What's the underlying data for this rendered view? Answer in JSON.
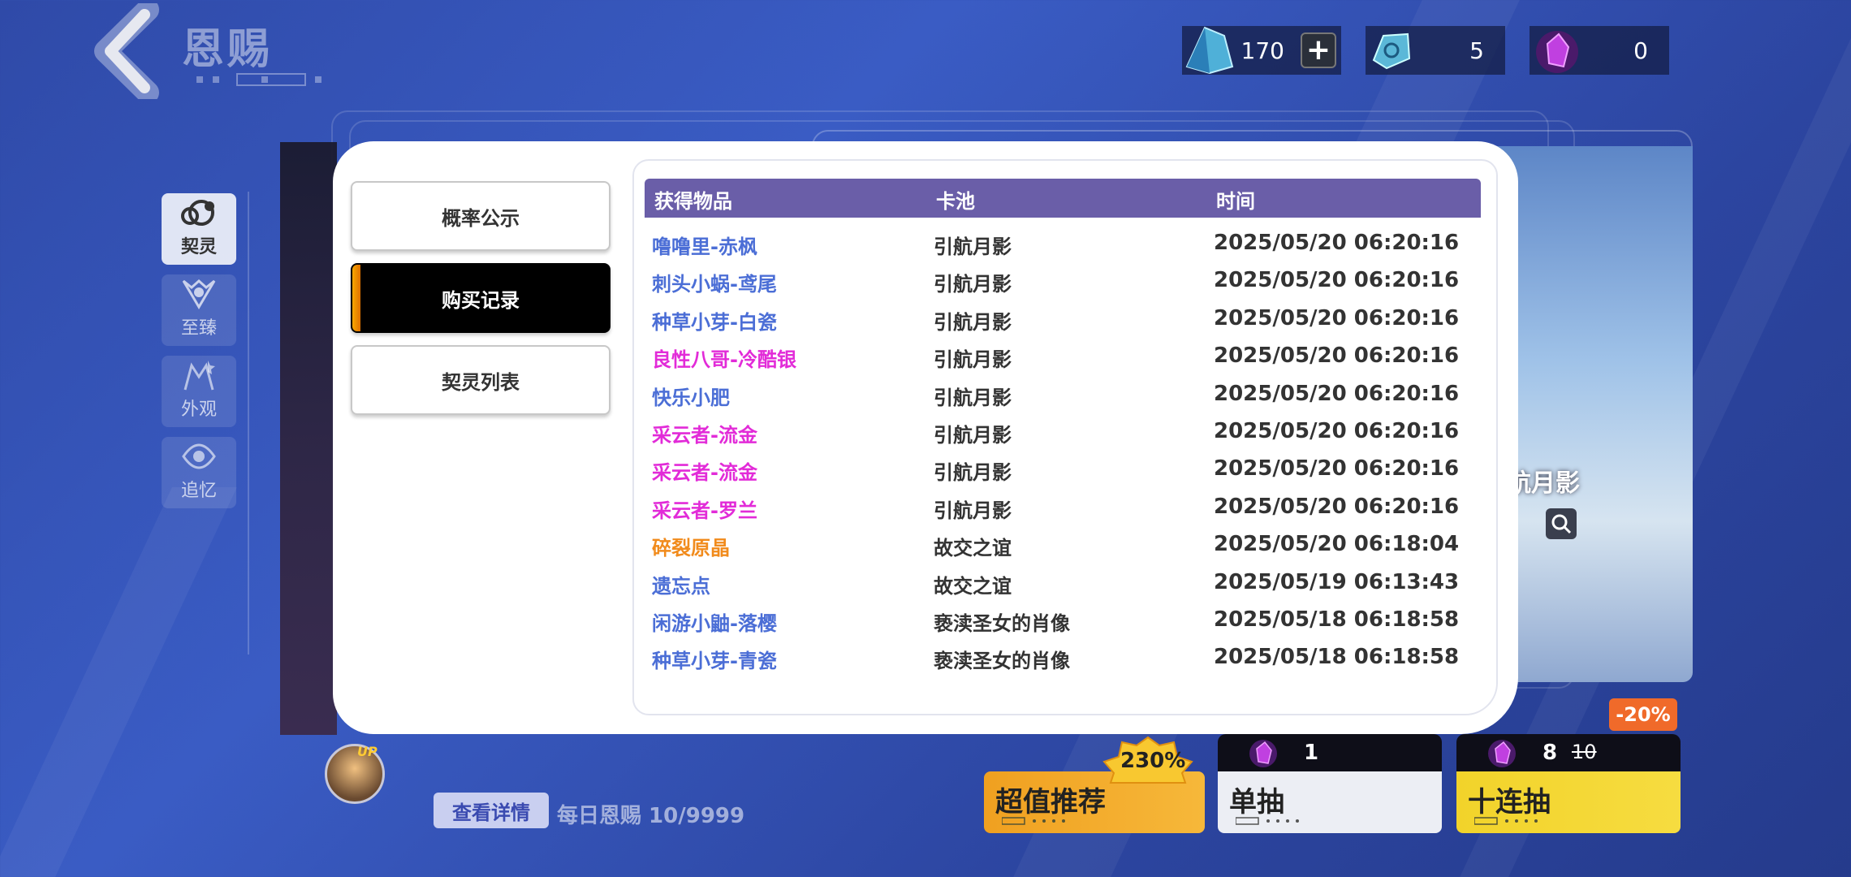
{
  "header": {
    "title": "恩赐",
    "currencies": [
      {
        "icon": "blue-crystal-icon",
        "value": "170"
      },
      {
        "icon": "blue-shard-icon",
        "value": "5"
      },
      {
        "icon": "purple-gem-icon",
        "value": "0"
      }
    ]
  },
  "sidebar": {
    "items": [
      {
        "label": "契灵",
        "icon": "pet-icon",
        "active": true
      },
      {
        "label": "至臻",
        "icon": "emblem-icon",
        "active": false
      },
      {
        "label": "外观",
        "icon": "outfit-icon",
        "active": false
      },
      {
        "label": "追忆",
        "icon": "memory-icon",
        "active": false
      }
    ]
  },
  "banner": {
    "name_partial": "航月影"
  },
  "modal": {
    "tabs": [
      {
        "label": "概率公示",
        "active": false
      },
      {
        "label": "购买记录",
        "active": true
      },
      {
        "label": "契灵列表",
        "active": false
      }
    ],
    "table": {
      "headers": [
        "获得物品",
        "卡池",
        "时间"
      ],
      "rows": [
        {
          "item": "噜噜里-赤枫",
          "pool": "引航月影",
          "time": "2025/05/20 06:20:16",
          "quality": "blue"
        },
        {
          "item": "刺头小蜗-鸢尾",
          "pool": "引航月影",
          "time": "2025/05/20 06:20:16",
          "quality": "blue"
        },
        {
          "item": "种草小芽-白瓷",
          "pool": "引航月影",
          "time": "2025/05/20 06:20:16",
          "quality": "blue"
        },
        {
          "item": "良性八哥-冷酷银",
          "pool": "引航月影",
          "time": "2025/05/20 06:20:16",
          "quality": "pink"
        },
        {
          "item": "快乐小肥",
          "pool": "引航月影",
          "time": "2025/05/20 06:20:16",
          "quality": "blue"
        },
        {
          "item": "采云者-流金",
          "pool": "引航月影",
          "time": "2025/05/20 06:20:16",
          "quality": "pink"
        },
        {
          "item": "采云者-流金",
          "pool": "引航月影",
          "time": "2025/05/20 06:20:16",
          "quality": "pink"
        },
        {
          "item": "采云者-罗兰",
          "pool": "引航月影",
          "time": "2025/05/20 06:20:16",
          "quality": "pink"
        },
        {
          "item": "碎裂原晶",
          "pool": "故交之谊",
          "time": "2025/05/20 06:18:04",
          "quality": "orange"
        },
        {
          "item": "遗忘点",
          "pool": "故交之谊",
          "time": "2025/05/19 06:13:43",
          "quality": "blue"
        },
        {
          "item": "闲游小鼬-落樱",
          "pool": "亵渎圣女的肖像",
          "time": "2025/05/18 06:18:58",
          "quality": "blue"
        },
        {
          "item": "种草小芽-青瓷",
          "pool": "亵渎圣女的肖像",
          "time": "2025/05/18 06:18:58",
          "quality": "blue"
        }
      ]
    }
  },
  "footer": {
    "up_badge": "UP",
    "detail_button": "查看详情",
    "daily_limit": "每日恩赐 10/9999",
    "recommend": {
      "label": "超值推荐",
      "badge": "230%"
    },
    "single_pull": {
      "label": "单抽",
      "cost": "1"
    },
    "ten_pull": {
      "label": "十连抽",
      "cost": "8",
      "old_cost": "10",
      "discount": "-20%"
    }
  },
  "colors": {
    "header_bg": "#6a5ea8",
    "quality_blue": "#4b6ed6",
    "quality_pink": "#e22bd8",
    "quality_orange": "#f18b1c",
    "recommend_bg": "#f0a020",
    "ten_pull_bg": "#f2d32a"
  }
}
